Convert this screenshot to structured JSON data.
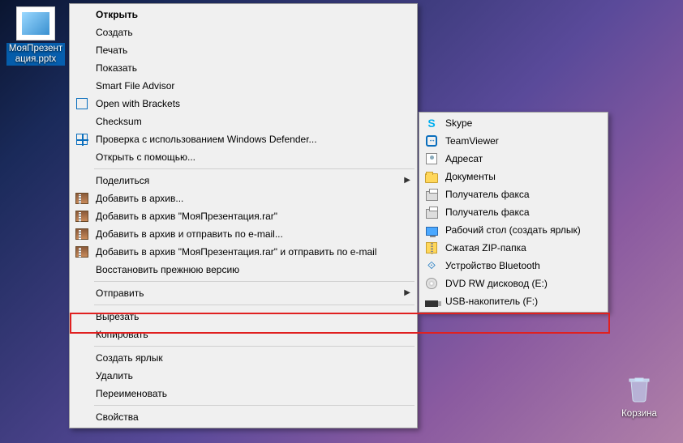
{
  "desktop": {
    "file": {
      "name": "МояПрезентация.pptx"
    },
    "recycle": {
      "name": "Корзина"
    }
  },
  "menu1": {
    "groups": [
      [
        {
          "id": "open",
          "label": "Открыть",
          "bold": true
        },
        {
          "id": "create",
          "label": "Создать"
        },
        {
          "id": "print",
          "label": "Печать"
        },
        {
          "id": "show",
          "label": "Показать"
        },
        {
          "id": "sfa",
          "label": "Smart File Advisor"
        },
        {
          "id": "brackets",
          "label": "Open with Brackets",
          "icon": "sq"
        },
        {
          "id": "checksum",
          "label": "Checksum"
        },
        {
          "id": "defender",
          "label": "Проверка с использованием Windows Defender...",
          "icon": "grid"
        },
        {
          "id": "openwith",
          "label": "Открыть с помощью..."
        }
      ],
      [
        {
          "id": "share",
          "label": "Поделиться",
          "submenu": true
        },
        {
          "id": "rar1",
          "label": "Добавить в архив...",
          "icon": "rar"
        },
        {
          "id": "rar2",
          "label": "Добавить в архив \"МояПрезентация.rar\"",
          "icon": "rar"
        },
        {
          "id": "rar3",
          "label": "Добавить в архив и отправить по e-mail...",
          "icon": "rar"
        },
        {
          "id": "rar4",
          "label": "Добавить в архив \"МояПрезентация.rar\" и отправить по e-mail",
          "icon": "rar"
        },
        {
          "id": "restore",
          "label": "Восстановить прежнюю версию"
        }
      ],
      [
        {
          "id": "sendto",
          "label": "Отправить",
          "submenu": true,
          "highlighted": true
        }
      ],
      [
        {
          "id": "cut",
          "label": "Вырезать"
        },
        {
          "id": "copy",
          "label": "Копировать"
        }
      ],
      [
        {
          "id": "shortcut",
          "label": "Создать ярлык"
        },
        {
          "id": "delete",
          "label": "Удалить"
        },
        {
          "id": "rename",
          "label": "Переименовать"
        }
      ],
      [
        {
          "id": "props",
          "label": "Свойства"
        }
      ]
    ]
  },
  "menu2": {
    "items": [
      {
        "id": "skype",
        "label": "Skype",
        "icon": "skype"
      },
      {
        "id": "teamviewer",
        "label": "TeamViewer",
        "icon": "tv"
      },
      {
        "id": "recipient",
        "label": "Адресат",
        "icon": "contact"
      },
      {
        "id": "documents",
        "label": "Документы",
        "icon": "folder"
      },
      {
        "id": "fax1",
        "label": "Получатель факса",
        "icon": "fax"
      },
      {
        "id": "fax2",
        "label": "Получатель факса",
        "icon": "fax"
      },
      {
        "id": "desktoplnk",
        "label": "Рабочий стол (создать ярлык)",
        "icon": "desktop"
      },
      {
        "id": "zip",
        "label": "Сжатая ZIP-папка",
        "icon": "zip"
      },
      {
        "id": "bluetooth",
        "label": "Устройство Bluetooth",
        "icon": "bt"
      },
      {
        "id": "dvd",
        "label": "DVD RW дисковод (E:)",
        "icon": "dvd"
      },
      {
        "id": "usb",
        "label": "USB-накопитель (F:)",
        "icon": "usb",
        "highlighted": true
      }
    ]
  }
}
